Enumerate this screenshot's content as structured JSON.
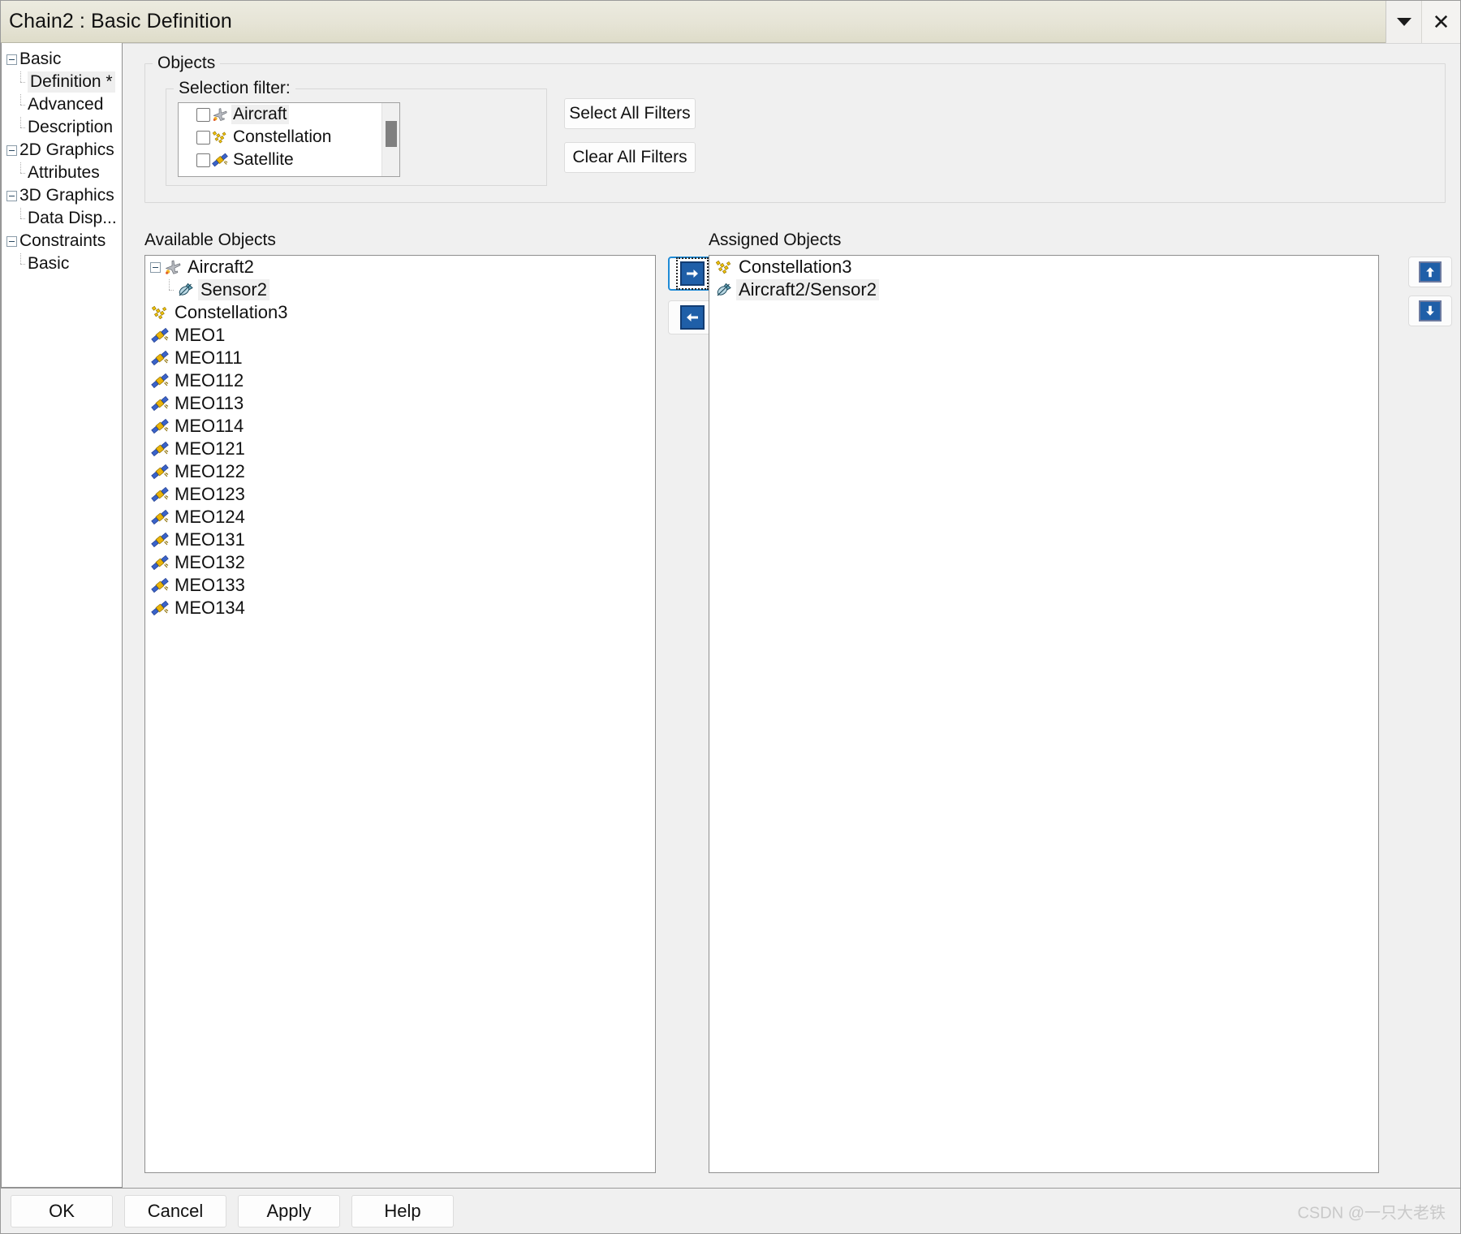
{
  "window": {
    "title": "Chain2 : Basic Definition",
    "title_buttons": [
      {
        "name": "collapse-dropdown",
        "icon": "chevron-down-icon"
      },
      {
        "name": "close",
        "icon": "close-icon",
        "label": "✕"
      }
    ]
  },
  "sidebar": {
    "items": [
      {
        "label": "Basic",
        "level": 0,
        "expander": true,
        "selected": false
      },
      {
        "label": "Definition *",
        "level": 1,
        "expander": false,
        "selected": true
      },
      {
        "label": "Advanced",
        "level": 1,
        "expander": false,
        "selected": false
      },
      {
        "label": "Description",
        "level": 1,
        "expander": false,
        "selected": false
      },
      {
        "label": "2D Graphics",
        "level": 0,
        "expander": true,
        "selected": false
      },
      {
        "label": "Attributes",
        "level": 1,
        "expander": false,
        "selected": false
      },
      {
        "label": "3D Graphics",
        "level": 0,
        "expander": true,
        "selected": false
      },
      {
        "label": "Data Disp...",
        "level": 1,
        "expander": false,
        "selected": false
      },
      {
        "label": "Constraints",
        "level": 0,
        "expander": true,
        "selected": false
      },
      {
        "label": "Basic",
        "level": 1,
        "expander": false,
        "selected": false
      }
    ]
  },
  "objects_group": {
    "legend": "Objects",
    "selection_filter": {
      "legend": "Selection filter:",
      "rows": [
        {
          "label": "Aircraft",
          "icon": "aircraft-icon",
          "checked": false,
          "highlighted": true
        },
        {
          "label": "Constellation",
          "icon": "constellation-icon",
          "checked": false,
          "highlighted": false
        },
        {
          "label": "Satellite",
          "icon": "satellite-icon",
          "checked": false,
          "highlighted": false
        }
      ],
      "scrollbar": true
    },
    "buttons": [
      {
        "label": "Select All Filters",
        "name": "select-all-filters-button"
      },
      {
        "label": "Clear All Filters",
        "name": "clear-all-filters-button"
      }
    ]
  },
  "available": {
    "label": "Available Objects",
    "items": [
      {
        "label": "Aircraft2",
        "icon": "aircraft-icon",
        "indent": 0,
        "expander": true,
        "highlighted": false
      },
      {
        "label": "Sensor2",
        "icon": "sensor-icon",
        "indent": 1,
        "expander": false,
        "highlighted": true
      },
      {
        "label": "Constellation3",
        "icon": "constellation-icon",
        "indent": 0,
        "expander": false,
        "highlighted": false
      },
      {
        "label": "MEO1",
        "icon": "satellite-icon",
        "indent": 0,
        "expander": false,
        "highlighted": false
      },
      {
        "label": "MEO111",
        "icon": "satellite-icon",
        "indent": 0,
        "expander": false,
        "highlighted": false
      },
      {
        "label": "MEO112",
        "icon": "satellite-icon",
        "indent": 0,
        "expander": false,
        "highlighted": false
      },
      {
        "label": "MEO113",
        "icon": "satellite-icon",
        "indent": 0,
        "expander": false,
        "highlighted": false
      },
      {
        "label": "MEO114",
        "icon": "satellite-icon",
        "indent": 0,
        "expander": false,
        "highlighted": false
      },
      {
        "label": "MEO121",
        "icon": "satellite-icon",
        "indent": 0,
        "expander": false,
        "highlighted": false
      },
      {
        "label": "MEO122",
        "icon": "satellite-icon",
        "indent": 0,
        "expander": false,
        "highlighted": false
      },
      {
        "label": "MEO123",
        "icon": "satellite-icon",
        "indent": 0,
        "expander": false,
        "highlighted": false
      },
      {
        "label": "MEO124",
        "icon": "satellite-icon",
        "indent": 0,
        "expander": false,
        "highlighted": false
      },
      {
        "label": "MEO131",
        "icon": "satellite-icon",
        "indent": 0,
        "expander": false,
        "highlighted": false
      },
      {
        "label": "MEO132",
        "icon": "satellite-icon",
        "indent": 0,
        "expander": false,
        "highlighted": false
      },
      {
        "label": "MEO133",
        "icon": "satellite-icon",
        "indent": 0,
        "expander": false,
        "highlighted": false
      },
      {
        "label": "MEO134",
        "icon": "satellite-icon",
        "indent": 0,
        "expander": false,
        "highlighted": false
      }
    ]
  },
  "assigned": {
    "label": "Assigned Objects",
    "items": [
      {
        "label": "Constellation3",
        "icon": "constellation-icon",
        "highlighted": false
      },
      {
        "label": "Aircraft2/Sensor2",
        "icon": "sensor-icon",
        "highlighted": true
      }
    ]
  },
  "transfer": [
    {
      "name": "assign-right-button",
      "icon": "arrow-right-icon",
      "focused": true
    },
    {
      "name": "unassign-left-button",
      "icon": "arrow-left-icon",
      "focused": false
    }
  ],
  "reorder": [
    {
      "name": "move-up-button",
      "icon": "arrow-up-icon"
    },
    {
      "name": "move-down-button",
      "icon": "arrow-down-icon"
    }
  ],
  "footer": {
    "buttons": [
      {
        "label": "OK",
        "name": "ok-button"
      },
      {
        "label": "Cancel",
        "name": "cancel-button"
      },
      {
        "label": "Apply",
        "name": "apply-button"
      },
      {
        "label": "Help",
        "name": "help-button"
      }
    ],
    "watermark": "CSDN @一只大老铁"
  },
  "colors": {
    "accent_blue": "#1f5fa8",
    "focus_blue": "#1e8ad6",
    "titlebar": "#e6e4d6",
    "highlight": "#efefef"
  }
}
